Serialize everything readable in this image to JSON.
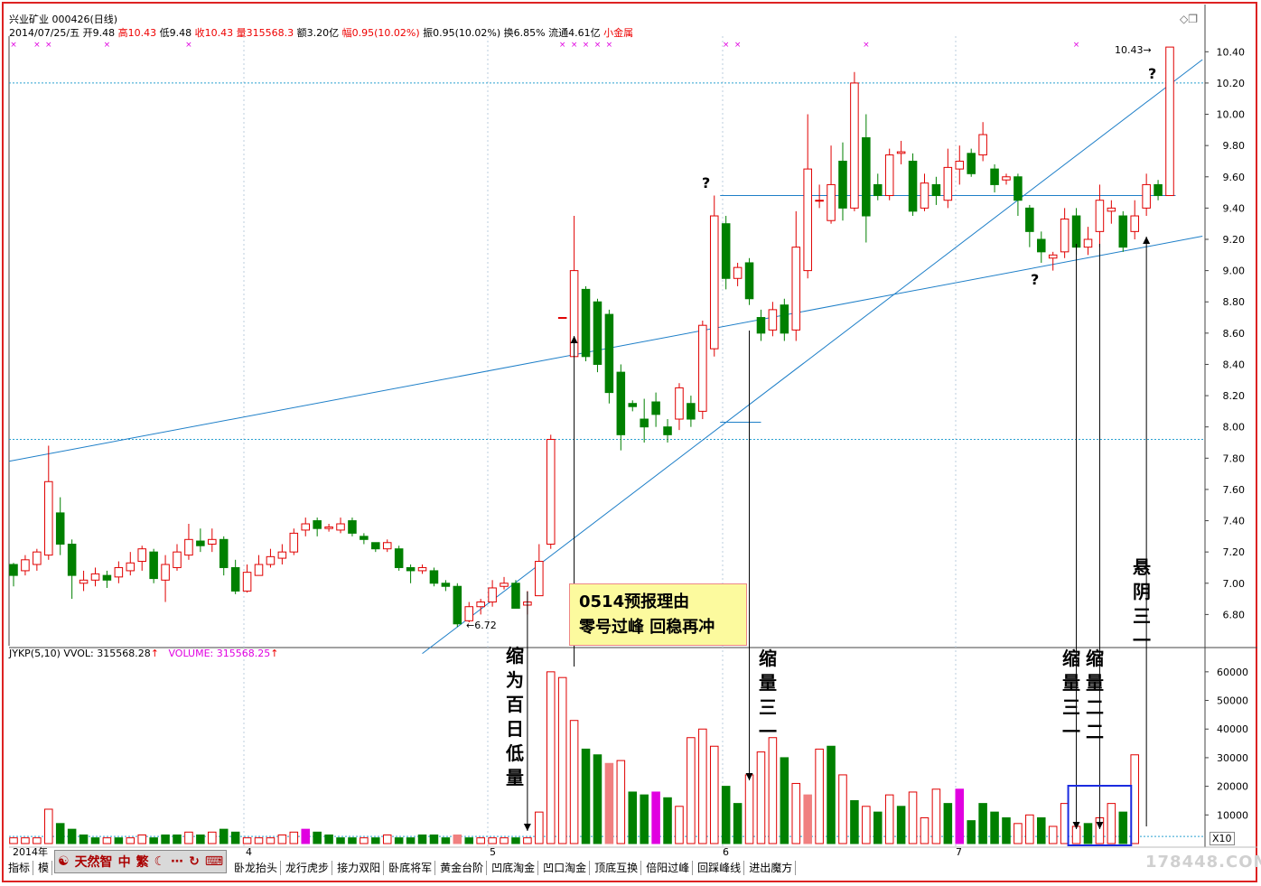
{
  "header": {
    "line1": "兴业矿业 000426(日线)",
    "date": "2014/07/25/五",
    "open_label": "开",
    "open": "9.48",
    "high_label": "高",
    "high": "10.43",
    "low_label": "低",
    "low": "9.48",
    "close_label": "收",
    "close": "10.43",
    "vol_label": "量",
    "vol": "315568.3",
    "amount": "额3.20亿",
    "range_label": "幅",
    "range": "0.95(10.02%)",
    "amp": "振0.95(10.02%)",
    "turnover": "换6.85%",
    "float": "流通4.61亿",
    "sector": "小金属"
  },
  "indicator_header": {
    "name": "JYKP(5,10)",
    "vvol": "VVOL: 315568.28",
    "volume": "VOLUME: 315568.25"
  },
  "annotations": {
    "box_line1": "0514预报理由",
    "box_line2": "零号过峰 回稳再冲",
    "v1": "缩为百日低量",
    "v2": "缩量三一",
    "v3": "缩量三一",
    "v4": "缩量二二",
    "v5": "悬阴三一",
    "q1": "?",
    "q2": "?",
    "q3": "?",
    "low_label": "6.72",
    "high_label": "10.43",
    "zoom": "X10"
  },
  "bottom_buttons": [
    "指标",
    "模",
    "卧龙抬头",
    "龙行虎步",
    "接力双阳",
    "卧底将军",
    "黄金台阶",
    "凹底淘金",
    "凹口淘金",
    "顶底互换",
    "倍阳过峰",
    "回踩峰线",
    "进出魔方"
  ],
  "logo": {
    "text1": "天然智",
    "text2": "中",
    "text3": "繁"
  },
  "watermark": "178448.COM",
  "colors": {
    "up": "#e00000",
    "down": "#008000",
    "line": "#1e7fc8",
    "grid": "#2aa0d0",
    "magenta": "#e000e0",
    "pink": "#f08080"
  },
  "chart_data": {
    "type": "candlestick",
    "title": "兴业矿业 000426(日线)",
    "price_axis": {
      "ticks": [
        "10.40",
        "10.20",
        "10.00",
        "9.80",
        "9.60",
        "9.40",
        "9.20",
        "9.00",
        "8.80",
        "8.60",
        "8.40",
        "8.20",
        "8.00",
        "7.80",
        "7.60",
        "7.40",
        "7.20",
        "7.00",
        "6.80"
      ],
      "min": 6.6,
      "max": 10.5
    },
    "volume_axis": {
      "ticks": [
        "60000",
        "50000",
        "40000",
        "30000",
        "20000",
        "10000"
      ],
      "min": 0,
      "max": 65000
    },
    "x_labels": [
      "2014年",
      "4",
      "5",
      "6",
      "7"
    ],
    "candles": [
      [
        7.12,
        7.05,
        7.13,
        6.98
      ],
      [
        7.08,
        7.15,
        7.18,
        7.05
      ],
      [
        7.12,
        7.2,
        7.22,
        7.08
      ],
      [
        7.18,
        7.65,
        7.88,
        7.15
      ],
      [
        7.45,
        7.25,
        7.55,
        7.18
      ],
      [
        7.25,
        7.05,
        7.28,
        6.9
      ],
      [
        7.0,
        7.02,
        7.08,
        6.95
      ],
      [
        7.02,
        7.06,
        7.1,
        6.98
      ],
      [
        7.05,
        7.02,
        7.08,
        6.97
      ],
      [
        7.04,
        7.1,
        7.14,
        7.0
      ],
      [
        7.08,
        7.13,
        7.2,
        7.05
      ],
      [
        7.14,
        7.22,
        7.24,
        7.08
      ],
      [
        7.2,
        7.03,
        7.22,
        7.0
      ],
      [
        7.02,
        7.12,
        7.18,
        6.88
      ],
      [
        7.1,
        7.2,
        7.25,
        7.08
      ],
      [
        7.18,
        7.28,
        7.38,
        7.15
      ],
      [
        7.27,
        7.24,
        7.35,
        7.2
      ],
      [
        7.25,
        7.28,
        7.35,
        7.2
      ],
      [
        7.28,
        7.1,
        7.3,
        7.05
      ],
      [
        7.1,
        6.95,
        7.15,
        6.93
      ],
      [
        6.95,
        7.07,
        7.12,
        6.94
      ],
      [
        7.05,
        7.12,
        7.18,
        7.05
      ],
      [
        7.12,
        7.17,
        7.22,
        7.1
      ],
      [
        7.16,
        7.2,
        7.25,
        7.12
      ],
      [
        7.2,
        7.32,
        7.35,
        7.18
      ],
      [
        7.34,
        7.38,
        7.42,
        7.3
      ],
      [
        7.4,
        7.35,
        7.42,
        7.3
      ],
      [
        7.35,
        7.36,
        7.38,
        7.33
      ],
      [
        7.34,
        7.38,
        7.42,
        7.32
      ],
      [
        7.4,
        7.32,
        7.42,
        7.3
      ],
      [
        7.3,
        7.28,
        7.32,
        7.25
      ],
      [
        7.26,
        7.22,
        7.26,
        7.2
      ],
      [
        7.22,
        7.26,
        7.28,
        7.2
      ],
      [
        7.22,
        7.1,
        7.24,
        7.08
      ],
      [
        7.1,
        7.08,
        7.12,
        7.0
      ],
      [
        7.08,
        7.1,
        7.12,
        7.06
      ],
      [
        7.08,
        7.0,
        7.1,
        6.98
      ],
      [
        7.0,
        6.98,
        7.02,
        6.95
      ],
      [
        6.98,
        6.74,
        7.0,
        6.72
      ],
      [
        6.76,
        6.85,
        6.88,
        6.75
      ],
      [
        6.85,
        6.88,
        6.9,
        6.8
      ],
      [
        6.88,
        6.97,
        7.02,
        6.85
      ],
      [
        6.98,
        7.0,
        7.04,
        6.96
      ],
      [
        7.0,
        6.84,
        7.02,
        6.84
      ],
      [
        6.86,
        6.88,
        6.95,
        6.8
      ],
      [
        6.92,
        7.14,
        7.25,
        6.92
      ],
      [
        7.25,
        7.92,
        7.95,
        7.22
      ],
      [
        8.7,
        8.7,
        8.7,
        8.7
      ],
      [
        8.45,
        9.0,
        9.35,
        8.45
      ],
      [
        8.88,
        8.45,
        8.9,
        8.42
      ],
      [
        8.8,
        8.4,
        8.82,
        8.35
      ],
      [
        8.72,
        8.22,
        8.75,
        8.15
      ],
      [
        8.35,
        7.95,
        8.4,
        7.85
      ],
      [
        8.15,
        8.13,
        8.17,
        8.1
      ],
      [
        8.05,
        8.0,
        8.18,
        7.9
      ],
      [
        8.16,
        8.08,
        8.22,
        8.0
      ],
      [
        8.0,
        7.95,
        8.05,
        7.9
      ],
      [
        8.05,
        8.25,
        8.28,
        7.98
      ],
      [
        8.15,
        8.05,
        8.2,
        8.0
      ],
      [
        8.1,
        8.65,
        8.68,
        8.05
      ],
      [
        8.5,
        9.35,
        9.48,
        8.45
      ],
      [
        9.3,
        8.95,
        9.35,
        8.88
      ],
      [
        8.95,
        9.02,
        9.05,
        8.9
      ],
      [
        9.05,
        8.82,
        9.08,
        8.78
      ],
      [
        8.7,
        8.6,
        8.75,
        8.55
      ],
      [
        8.62,
        8.75,
        8.8,
        8.58
      ],
      [
        8.78,
        8.6,
        8.82,
        8.55
      ],
      [
        8.62,
        9.15,
        9.38,
        8.55
      ],
      [
        9.0,
        9.65,
        10.0,
        8.95
      ],
      [
        9.45,
        9.45,
        9.55,
        9.4
      ],
      [
        9.32,
        9.55,
        9.8,
        9.3
      ],
      [
        9.7,
        9.4,
        9.82,
        9.32
      ],
      [
        9.4,
        10.2,
        10.27,
        9.38
      ],
      [
        9.85,
        9.35,
        10.0,
        9.18
      ],
      [
        9.55,
        9.48,
        9.62,
        9.45
      ],
      [
        9.48,
        9.74,
        9.78,
        9.45
      ],
      [
        9.75,
        9.76,
        9.83,
        9.68
      ],
      [
        9.7,
        9.38,
        9.75,
        9.35
      ],
      [
        9.4,
        9.56,
        9.62,
        9.38
      ],
      [
        9.55,
        9.48,
        9.6,
        9.42
      ],
      [
        9.45,
        9.66,
        9.78,
        9.4
      ],
      [
        9.65,
        9.7,
        9.8,
        9.55
      ],
      [
        9.75,
        9.62,
        9.78,
        9.6
      ],
      [
        9.74,
        9.87,
        9.95,
        9.7
      ],
      [
        9.65,
        9.55,
        9.68,
        9.5
      ],
      [
        9.58,
        9.6,
        9.62,
        9.55
      ],
      [
        9.6,
        9.45,
        9.62,
        9.35
      ],
      [
        9.4,
        9.25,
        9.42,
        9.15
      ],
      [
        9.2,
        9.12,
        9.25,
        9.05
      ],
      [
        9.08,
        9.1,
        9.12,
        9.0
      ],
      [
        9.12,
        9.33,
        9.4,
        9.08
      ],
      [
        9.35,
        9.15,
        9.4,
        9.1
      ],
      [
        9.15,
        9.2,
        9.28,
        9.1
      ],
      [
        9.25,
        9.45,
        9.55,
        9.15
      ],
      [
        9.38,
        9.4,
        9.45,
        9.3
      ],
      [
        9.35,
        9.15,
        9.38,
        9.12
      ],
      [
        9.25,
        9.35,
        9.45,
        9.2
      ],
      [
        9.4,
        9.55,
        9.62,
        9.35
      ],
      [
        9.55,
        9.48,
        9.58,
        9.45
      ],
      [
        9.48,
        10.43,
        10.43,
        9.48
      ]
    ],
    "volumes": [
      [
        2000,
        1
      ],
      [
        2000,
        1
      ],
      [
        2000,
        1
      ],
      [
        12000,
        1
      ],
      [
        7000,
        0
      ],
      [
        5000,
        0
      ],
      [
        3000,
        0
      ],
      [
        2000,
        0
      ],
      [
        2000,
        1
      ],
      [
        2000,
        0
      ],
      [
        2000,
        1
      ],
      [
        3000,
        1
      ],
      [
        2000,
        0
      ],
      [
        3000,
        0
      ],
      [
        3000,
        0
      ],
      [
        4000,
        1
      ],
      [
        3000,
        0
      ],
      [
        4000,
        1
      ],
      [
        5000,
        0
      ],
      [
        4000,
        0
      ],
      [
        2000,
        1
      ],
      [
        2000,
        1
      ],
      [
        2000,
        1
      ],
      [
        3000,
        1
      ],
      [
        4000,
        1
      ],
      [
        5000,
        2
      ],
      [
        4000,
        0
      ],
      [
        3000,
        0
      ],
      [
        2000,
        0
      ],
      [
        2000,
        0
      ],
      [
        2000,
        1
      ],
      [
        2000,
        0
      ],
      [
        3000,
        1
      ],
      [
        2000,
        0
      ],
      [
        2000,
        0
      ],
      [
        3000,
        0
      ],
      [
        3000,
        0
      ],
      [
        2000,
        0
      ],
      [
        3000,
        3
      ],
      [
        2000,
        0
      ],
      [
        2000,
        1
      ],
      [
        2000,
        1
      ],
      [
        2000,
        1
      ],
      [
        2000,
        0
      ],
      [
        2000,
        1
      ],
      [
        11000,
        1
      ],
      [
        60000,
        1
      ],
      [
        58000,
        1
      ],
      [
        43000,
        1
      ],
      [
        33000,
        0
      ],
      [
        31000,
        0
      ],
      [
        28000,
        3
      ],
      [
        29000,
        1
      ],
      [
        18000,
        0
      ],
      [
        17000,
        0
      ],
      [
        18000,
        2
      ],
      [
        16000,
        0
      ],
      [
        13000,
        1
      ],
      [
        37000,
        1
      ],
      [
        40000,
        1
      ],
      [
        34000,
        1
      ],
      [
        20000,
        0
      ],
      [
        14000,
        0
      ],
      [
        24000,
        1
      ],
      [
        32000,
        1
      ],
      [
        37000,
        1
      ],
      [
        30000,
        0
      ],
      [
        21000,
        1
      ],
      [
        17000,
        3
      ],
      [
        33000,
        1
      ],
      [
        34000,
        0
      ],
      [
        24000,
        1
      ],
      [
        15000,
        0
      ],
      [
        13000,
        1
      ],
      [
        11000,
        0
      ],
      [
        17000,
        1
      ],
      [
        13000,
        0
      ],
      [
        18000,
        1
      ],
      [
        9000,
        1
      ],
      [
        19000,
        1
      ],
      [
        14000,
        0
      ],
      [
        19000,
        2
      ],
      [
        8000,
        0
      ],
      [
        14000,
        0
      ],
      [
        11000,
        0
      ],
      [
        9000,
        0
      ],
      [
        7000,
        1
      ],
      [
        10000,
        1
      ],
      [
        9000,
        0
      ],
      [
        6000,
        1
      ],
      [
        14000,
        1
      ],
      [
        6000,
        1
      ],
      [
        7000,
        0
      ],
      [
        9000,
        1
      ],
      [
        14000,
        1
      ],
      [
        11000,
        0
      ],
      [
        31000,
        1
      ]
    ]
  }
}
